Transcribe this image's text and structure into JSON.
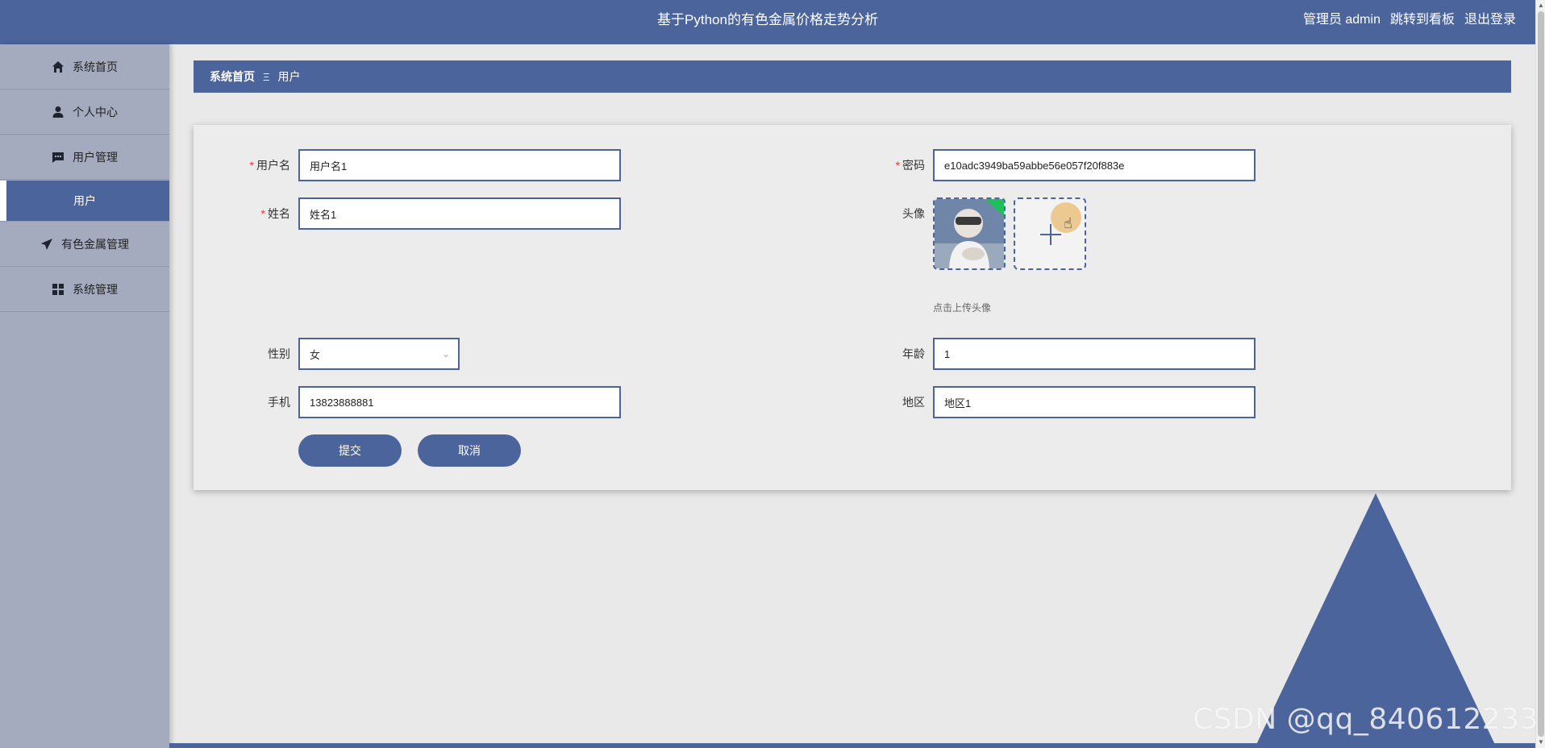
{
  "header": {
    "title": "基于Python的有色金属价格走势分析",
    "user_label": "管理员 admin",
    "dashboard_link": "跳转到看板",
    "logout_link": "退出登录"
  },
  "sidebar": {
    "items": [
      {
        "label": "系统首页",
        "icon": "home-icon"
      },
      {
        "label": "个人中心",
        "icon": "user-icon"
      },
      {
        "label": "用户管理",
        "icon": "chat-icon"
      },
      {
        "label": "用户",
        "icon": ""
      },
      {
        "label": "有色金属管理",
        "icon": "send-icon"
      },
      {
        "label": "系统管理",
        "icon": "grid-icon"
      }
    ]
  },
  "breadcrumb": {
    "home": "系统首页",
    "separator": "Ξ",
    "current": "用户"
  },
  "form": {
    "username": {
      "label": "用户名",
      "value": "用户名1"
    },
    "password": {
      "label": "密码",
      "value": "e10adc3949ba59abbe56e057f20f883e"
    },
    "name": {
      "label": "姓名",
      "value": "姓名1"
    },
    "avatar": {
      "label": "头像",
      "tip": "点击上传头像"
    },
    "gender": {
      "label": "性别",
      "value": "女"
    },
    "age": {
      "label": "年龄",
      "value": "1"
    },
    "phone": {
      "label": "手机",
      "value": "13823888881"
    },
    "region": {
      "label": "地区",
      "value": "地区1"
    },
    "submit_label": "提交",
    "cancel_label": "取消"
  },
  "watermark": "CSDN @qq_840612233",
  "colors": {
    "primary": "#4c649c",
    "sidebar": "#a4abbe",
    "background": "#e9e9e9"
  }
}
